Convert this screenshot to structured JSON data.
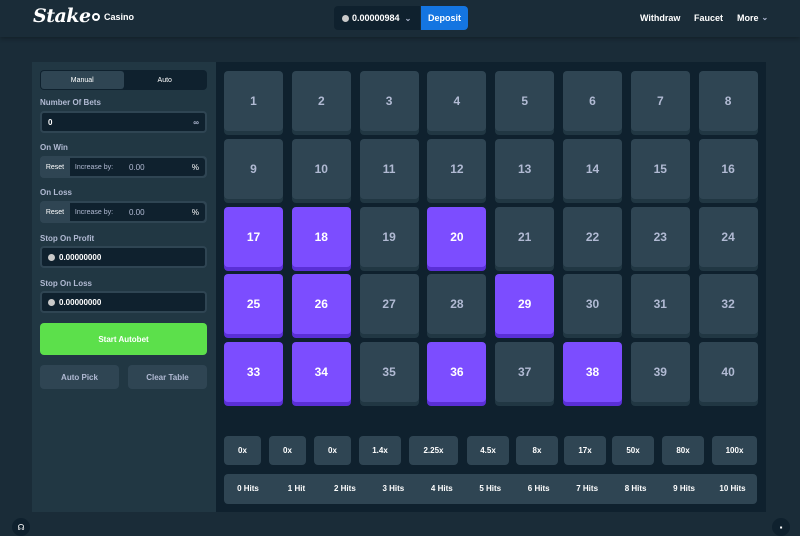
{
  "header": {
    "logo": "Stake",
    "casino_label": "Casino",
    "balance": "0.00000984",
    "deposit_label": "Deposit",
    "nav": [
      "Withdraw",
      "Faucet",
      "More"
    ]
  },
  "panel": {
    "tabs": [
      {
        "label": "Manual",
        "active": false
      },
      {
        "label": "Auto",
        "active": true
      }
    ],
    "number_of_bets_label": "Number Of Bets",
    "number_of_bets_value": "0",
    "infinity": "∞",
    "on_win_label": "On Win",
    "on_loss_label": "On Loss",
    "reset_label": "Reset",
    "increase_label": "Increase by:",
    "on_win_value": "0.00",
    "on_loss_value": "0.00",
    "percent": "%",
    "stop_profit_label": "Stop On Profit",
    "stop_profit_value": "0.00000000",
    "stop_loss_label": "Stop On Loss",
    "stop_loss_value": "0.00000000",
    "start_label": "Start Autobet",
    "auto_pick_label": "Auto Pick",
    "clear_table_label": "Clear Table"
  },
  "board": {
    "tiles": [
      1,
      2,
      3,
      4,
      5,
      6,
      7,
      8,
      9,
      10,
      11,
      12,
      13,
      14,
      15,
      16,
      17,
      18,
      19,
      20,
      21,
      22,
      23,
      24,
      25,
      26,
      27,
      28,
      29,
      30,
      31,
      32,
      33,
      34,
      35,
      36,
      37,
      38,
      39,
      40
    ],
    "selected": [
      17,
      18,
      20,
      25,
      26,
      29,
      33,
      34,
      36,
      38
    ],
    "multipliers": [
      "0x",
      "0x",
      "0x",
      "1.4x",
      "2.25x",
      "4.5x",
      "8x",
      "17x",
      "50x",
      "80x",
      "100x"
    ],
    "hits": [
      "0 Hits",
      "1 Hit",
      "2 Hits",
      "3 Hits",
      "4 Hits",
      "5 Hits",
      "6 Hits",
      "7 Hits",
      "8 Hits",
      "9 Hits",
      "10 Hits"
    ]
  },
  "colors": {
    "selected": "#7c4dff",
    "start": "#5ce04b",
    "deposit": "#1475e1"
  }
}
